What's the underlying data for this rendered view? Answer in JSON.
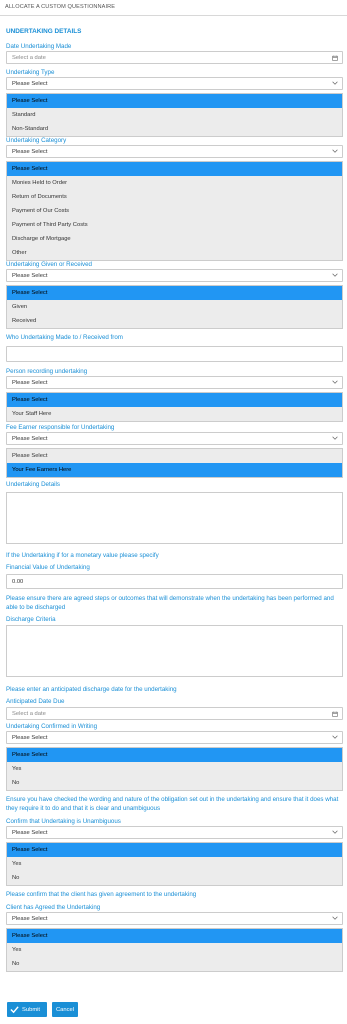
{
  "header": {
    "title": "ALLOCATE A CUSTOM QUESTIONNAIRE"
  },
  "section": {
    "title": "UNDERTAKING DETAILS"
  },
  "date_made": {
    "label": "Date Undertaking Made",
    "placeholder": "Select a date"
  },
  "type": {
    "label": "Undertaking Type",
    "value": "Please Select",
    "options": [
      "Please Select",
      "Standard",
      "Non-Standard"
    ]
  },
  "category": {
    "label": "Undertaking Category",
    "value": "Please Select",
    "options": [
      "Please Select",
      "Monies Held to Order",
      "Return of Documents",
      "Payment of Our Costs",
      "Payment of Third Party Costs",
      "Discharge of Mortgage",
      "Other"
    ]
  },
  "given_received": {
    "label": "Undertaking Given or Received",
    "value": "Please Select",
    "options": [
      "Please Select",
      "Given",
      "Received"
    ]
  },
  "made_to": {
    "label": "Who Undertaking Made to / Received from"
  },
  "person": {
    "label": "Person recording undertaking",
    "value": "Please Select",
    "options": [
      "Please Select",
      "Your Staff Here"
    ]
  },
  "fee_earner": {
    "label": "Fee Earner responsible for Undertaking",
    "value": "Please Select",
    "options": [
      "Please Select",
      "Your Fee Earners Here"
    ]
  },
  "details": {
    "label": "Undertaking Details"
  },
  "monetary_note": "If the Undertaking if for a monetary value please specify",
  "financial": {
    "label": "Financial Value of Undertaking",
    "value": "0.00"
  },
  "steps_note": "Please ensure there are agreed steps or outcomes that will demonstrate when the undertaking has been performed and able to be discharged",
  "discharge": {
    "label": "Discharge Criteria"
  },
  "anticipated_note": "Please enter an anticipated discharge date for the undertaking",
  "anticipated": {
    "label": "Anticipated Date Due",
    "placeholder": "Select a date"
  },
  "confirmed": {
    "label": "Undertaking Confirmed in Writing",
    "value": "Please Select",
    "options": [
      "Please Select",
      "Yes",
      "No"
    ]
  },
  "ensure_note": "Ensure you have checked the wording and nature of the obligation set out in the undertaking and ensure that it does what they require it to do and that it is clear and unambiguous",
  "unambiguous": {
    "label": "Confirm that Undertaking is Unambiguous",
    "value": "Please Select",
    "options": [
      "Please Select",
      "Yes",
      "No"
    ]
  },
  "client_note": "Please confirm that the client has given agreement to the undertaking",
  "client_agreed": {
    "label": "Client has Agreed the Undertaking",
    "value": "Please Select",
    "options": [
      "Please Select",
      "Yes",
      "No"
    ]
  },
  "buttons": {
    "submit": "Submit",
    "cancel": "Cancel"
  },
  "colors": {
    "accent": "#1a8fd6",
    "selected": "#2196f3"
  }
}
